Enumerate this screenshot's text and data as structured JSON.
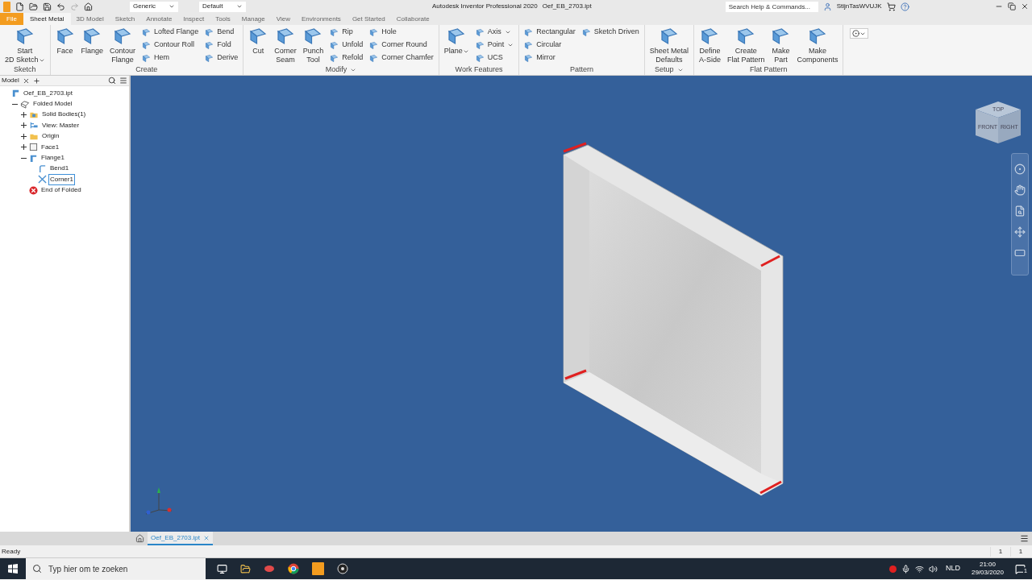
{
  "title_bar": {
    "appearance": "Generic",
    "style": "Default",
    "app_title": "Autodesk Inventor Professional 2020",
    "file_name": "Oef_EB_2703.ipt",
    "search": {
      "placeholder": "Search Help & Commands..."
    },
    "user": "StijnTasWVUJK"
  },
  "ribbon_tabs": [
    {
      "label": "File",
      "selected": false,
      "kind": "file"
    },
    {
      "label": "Sheet Metal",
      "selected": true,
      "kind": "tab"
    },
    {
      "label": "3D Model",
      "selected": false,
      "kind": "tab"
    },
    {
      "label": "Sketch",
      "selected": false,
      "kind": "tab"
    },
    {
      "label": "Annotate",
      "selected": false,
      "kind": "tab"
    },
    {
      "label": "Inspect",
      "selected": false,
      "kind": "tab"
    },
    {
      "label": "Tools",
      "selected": false,
      "kind": "tab"
    },
    {
      "label": "Manage",
      "selected": false,
      "kind": "tab"
    },
    {
      "label": "View",
      "selected": false,
      "kind": "tab"
    },
    {
      "label": "Environments",
      "selected": false,
      "kind": "tab"
    },
    {
      "label": "Get Started",
      "selected": false,
      "kind": "tab"
    },
    {
      "label": "Collaborate",
      "selected": false,
      "kind": "tab"
    }
  ],
  "ribbon_panels": [
    {
      "title": "Sketch",
      "has_menu": false,
      "items": [
        {
          "kind": "large",
          "lines": [
            "Start",
            "2D Sketch"
          ],
          "dropdown": true
        }
      ]
    },
    {
      "title": "Create",
      "has_menu": false,
      "items": [
        {
          "kind": "large",
          "lines": [
            "Face"
          ],
          "dropdown": false
        },
        {
          "kind": "large",
          "lines": [
            "Flange"
          ],
          "dropdown": false
        },
        {
          "kind": "large",
          "lines": [
            "Contour",
            "Flange"
          ],
          "dropdown": false
        },
        {
          "kind": "column",
          "tools": [
            {
              "label": "Lofted Flange",
              "dropdown": false
            },
            {
              "label": "Contour Roll",
              "dropdown": false
            },
            {
              "label": "Hem",
              "dropdown": false
            }
          ]
        },
        {
          "kind": "column",
          "tools": [
            {
              "label": "Bend",
              "dropdown": false
            },
            {
              "label": "Fold",
              "dropdown": false
            },
            {
              "label": "Derive",
              "dropdown": false
            }
          ]
        }
      ]
    },
    {
      "title": "Modify",
      "has_menu": true,
      "items": [
        {
          "kind": "large",
          "lines": [
            "Cut"
          ],
          "dropdown": false
        },
        {
          "kind": "large",
          "lines": [
            "Corner",
            "Seam"
          ],
          "dropdown": false
        },
        {
          "kind": "large",
          "lines": [
            "Punch",
            "Tool"
          ],
          "dropdown": false
        },
        {
          "kind": "column",
          "tools": [
            {
              "label": "Rip",
              "dropdown": false
            },
            {
              "label": "Unfold",
              "dropdown": false
            },
            {
              "label": "Refold",
              "dropdown": false
            }
          ]
        },
        {
          "kind": "column",
          "tools": [
            {
              "label": "Hole",
              "dropdown": false
            },
            {
              "label": "Corner Round",
              "dropdown": false
            },
            {
              "label": "Corner Chamfer",
              "dropdown": false
            }
          ]
        }
      ]
    },
    {
      "title": "Work Features",
      "has_menu": false,
      "items": [
        {
          "kind": "large",
          "lines": [
            "Plane"
          ],
          "dropdown": true
        },
        {
          "kind": "column",
          "tools": [
            {
              "label": "Axis",
              "dropdown": true
            },
            {
              "label": "Point",
              "dropdown": true
            },
            {
              "label": "UCS",
              "dropdown": false
            }
          ]
        }
      ]
    },
    {
      "title": "Pattern",
      "has_menu": false,
      "items": [
        {
          "kind": "column",
          "tools": [
            {
              "label": "Rectangular",
              "dropdown": false
            },
            {
              "label": "Circular",
              "dropdown": false
            },
            {
              "label": "Mirror",
              "dropdown": false
            }
          ]
        },
        {
          "kind": "column",
          "tools": [
            {
              "label": "Sketch Driven",
              "dropdown": false
            }
          ]
        }
      ]
    },
    {
      "title": "Setup",
      "has_menu": true,
      "items": [
        {
          "kind": "large",
          "lines": [
            "Sheet Metal",
            "Defaults"
          ],
          "dropdown": false
        }
      ]
    },
    {
      "title": "Flat Pattern",
      "has_menu": false,
      "items": [
        {
          "kind": "large",
          "lines": [
            "Define",
            "A-Side"
          ],
          "dropdown": false
        },
        {
          "kind": "large",
          "lines": [
            "Create",
            "Flat Pattern"
          ],
          "dropdown": false
        },
        {
          "kind": "large",
          "lines": [
            "Make",
            "Part"
          ],
          "dropdown": false
        },
        {
          "kind": "large",
          "lines": [
            "Make",
            "Components"
          ],
          "dropdown": false
        }
      ]
    }
  ],
  "browser": {
    "tab": "Model",
    "tree": [
      {
        "label": "Oef_EB_2703.ipt",
        "kind": "part",
        "selected": false,
        "children": [
          {
            "label": "Folded Model",
            "kind": "model",
            "selected": false,
            "expanded": true,
            "children": [
              {
                "label": "Solid Bodies(1)",
                "kind": "bodies",
                "selected": false,
                "expanded": false
              },
              {
                "label": "View: Master",
                "kind": "view",
                "selected": false,
                "expanded": false
              },
              {
                "label": "Origin",
                "kind": "folder",
                "selected": false,
                "expanded": false
              },
              {
                "label": "Face1",
                "kind": "face",
                "selected": false,
                "expanded": false
              },
              {
                "label": "Flange1",
                "kind": "flange",
                "selected": false,
                "expanded": true,
                "children": [
                  {
                    "label": "Bend1",
                    "kind": "bend",
                    "selected": false
                  },
                  {
                    "label": "Corner1",
                    "kind": "corner",
                    "selected": true
                  }
                ]
              },
              {
                "label": "End of Folded",
                "kind": "end",
                "selected": false
              }
            ]
          }
        ]
      }
    ]
  },
  "viewcube": {
    "faces": [
      "TOP",
      "FRONT",
      "RIGHT"
    ]
  },
  "document_tabs": [
    {
      "label": "Oef_EB_2703.ipt",
      "selected": true
    }
  ],
  "status_bar": {
    "message": "Ready",
    "counters": [
      "1",
      "1"
    ]
  },
  "taskbar": {
    "search": {
      "placeholder": "Typ hier om te zoeken"
    },
    "language": "NLD",
    "time": "21:00",
    "date": "29/03/2020",
    "notifications": "1"
  }
}
